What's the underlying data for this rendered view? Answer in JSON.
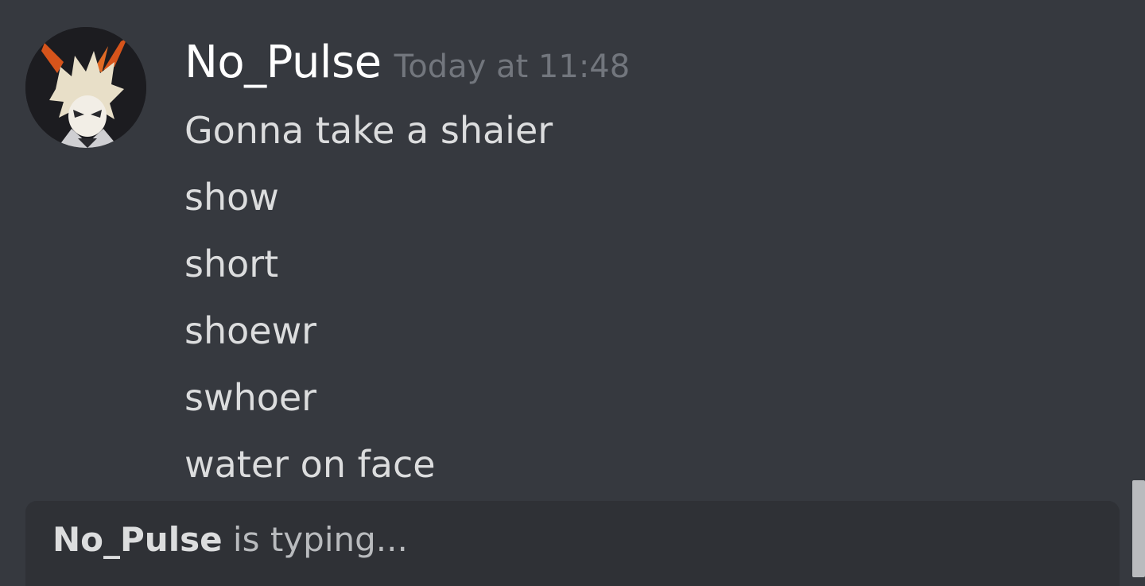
{
  "message": {
    "author": "No_Pulse",
    "timestamp": "Today at 11:48",
    "avatar_icon": "anime-character-avatar-icon",
    "lines": [
      "Gonna take a shaier",
      "show",
      "short",
      "shoewr",
      "swhoer",
      "water on face"
    ]
  },
  "typing": {
    "user": "No_Pulse",
    "suffix": " is typing..."
  },
  "colors": {
    "background": "#36393f",
    "typing_bar": "#2f3136",
    "username": "#ffffff",
    "timestamp": "#72767d",
    "message_text": "#dcddde"
  }
}
